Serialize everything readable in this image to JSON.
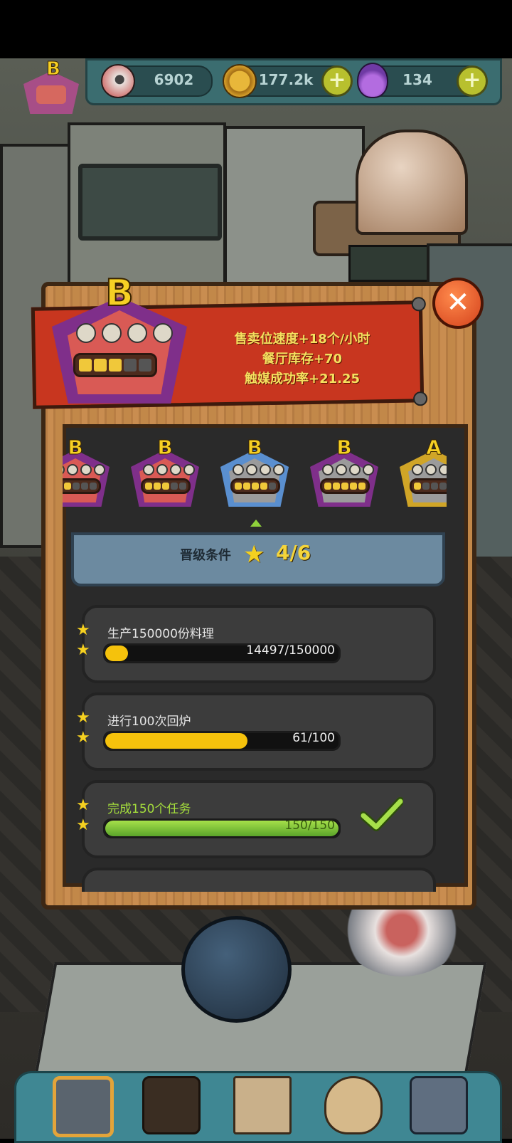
{
  "resources": {
    "eyeballs": "6902",
    "gold": "177.2k",
    "potions": "134"
  },
  "current_rank": {
    "letter": "B",
    "filled_slots": 3,
    "total_slots": 5
  },
  "bonuses": [
    "售卖位速度+18个/小时",
    "餐厅库存+70",
    "触媒成功率+21.25"
  ],
  "ranks": [
    {
      "letter": "B",
      "filled_slots": 2,
      "style": "pink"
    },
    {
      "letter": "B",
      "filled_slots": 3,
      "style": "pink"
    },
    {
      "letter": "B",
      "filled_slots": 4,
      "style": "grey-current"
    },
    {
      "letter": "B",
      "filled_slots": 5,
      "style": "grey"
    },
    {
      "letter": "A",
      "filled_slots": 1,
      "style": "gold"
    }
  ],
  "requirements": {
    "label": "晋级条件",
    "progress": "4/6"
  },
  "tasks": [
    {
      "label": "生产150000份料理",
      "progress": "14497/150000",
      "fraction": 0.097,
      "done": false
    },
    {
      "label": "进行100次回炉",
      "progress": "61/100",
      "fraction": 0.61,
      "done": false
    },
    {
      "label": "完成150个任务",
      "progress": "150/150",
      "fraction": 1.0,
      "done": true
    }
  ],
  "colors": {
    "banner_red": "#c8361f",
    "bonus_text": "#f5e05f",
    "progress_yellow": "#f5c20c",
    "progress_green": "#7cc43a",
    "header_blue": "#6c8aa0"
  },
  "icons": {
    "close": "close-icon",
    "star": "star-icon",
    "check": "check-icon",
    "plus": "plus-icon"
  }
}
